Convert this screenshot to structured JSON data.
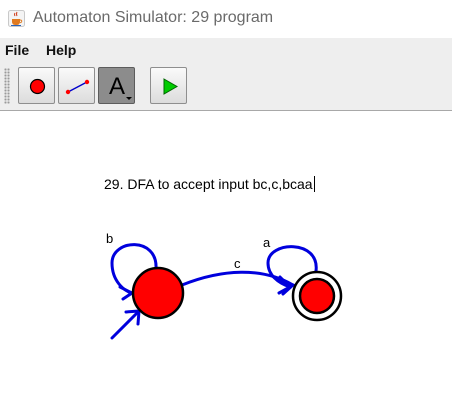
{
  "window": {
    "title": "Automaton Simulator: 29 program",
    "icon": "java-cup-icon"
  },
  "menu": {
    "file": "File",
    "help": "Help"
  },
  "toolbar": {
    "tools": [
      {
        "name": "state-tool",
        "icon": "red-circle-icon",
        "selected": false
      },
      {
        "name": "transition-tool",
        "icon": "edge-icon",
        "selected": false
      },
      {
        "name": "text-tool",
        "icon": "letter-a-icon",
        "label": "A",
        "selected": true
      },
      {
        "name": "simulate-tool",
        "icon": "green-play-icon",
        "selected": false
      }
    ]
  },
  "canvas": {
    "note": "29. DFA to accept input bc,c,bcaa",
    "states": [
      {
        "id": "q0",
        "initial": true,
        "accepting": false
      },
      {
        "id": "q1",
        "initial": false,
        "accepting": true
      }
    ],
    "transitions": [
      {
        "from": "q0",
        "to": "q0",
        "label": "b"
      },
      {
        "from": "q0",
        "to": "q1",
        "label": "c"
      },
      {
        "from": "q1",
        "to": "q1",
        "label": "a"
      }
    ]
  },
  "colors": {
    "state_fill": "#ff0000",
    "edge": "#0000dd",
    "toolbar_bg": "#eeeeee",
    "play_green": "#00cc00"
  }
}
